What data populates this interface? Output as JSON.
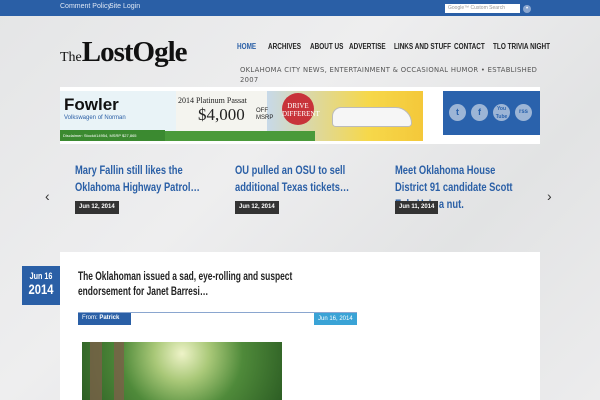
{
  "topbar": {
    "links": [
      "Comment Policy",
      "Site Login"
    ],
    "search_placeholder": "Google™ Custom Search"
  },
  "logo": {
    "the": "The",
    "name": "LostOgle"
  },
  "nav": [
    "HOME",
    "ARCHIVES",
    "ABOUT US",
    "ADVERTISE",
    "LINKS AND STUFF",
    "CONTACT",
    "TLO TRIVIA NIGHT"
  ],
  "tagline": "OKLAHOMA CITY NEWS, ENTERTAINMENT & OCCASIONAL HUMOR • ESTABLISHED 2007",
  "ad": {
    "brand": "Fowler",
    "sub": "Volkswagen of Norman",
    "disclaimer": "Disclaimer: Stock#14954, MSRP $27,865",
    "model": "2014 Platinum Passat",
    "price": "$4,000",
    "off": "OFF MSRP",
    "drive": "DRIVE DIFFERENT"
  },
  "social": [
    "t",
    "f",
    "You Tube",
    "rss"
  ],
  "slider": [
    {
      "title": "Mary Fallin still likes the Oklahoma Highway Patrol…",
      "date": "Jun 12, 2014"
    },
    {
      "title": "OU pulled an OSU to sell additional Texas tickets…",
      "date": "Jun 12, 2014"
    },
    {
      "title": "Meet Oklahoma House District 91 candidate Scott Esk. He's a nut.",
      "date": "Jun 11, 2014"
    }
  ],
  "arrows": {
    "prev": "‹",
    "next": "›"
  },
  "post": {
    "badge_month": "Jun 16",
    "badge_year": "2014",
    "title": "The Oklahoman issued a sad, eye-rolling and suspect endorsement for Janet Barresi…",
    "from_label": "From:",
    "author": "Patrick",
    "date": "Jun 16, 2014"
  }
}
